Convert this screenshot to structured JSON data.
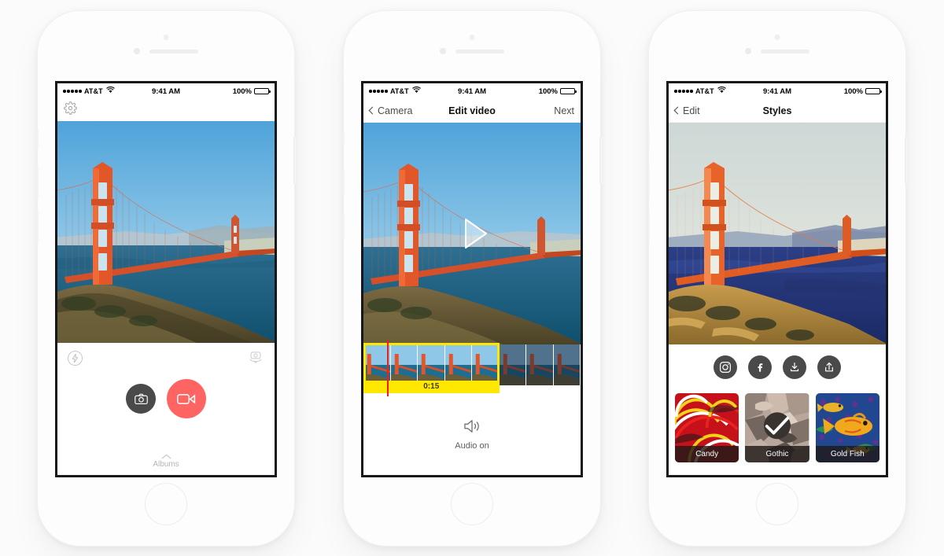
{
  "theme": {
    "page_bg": "#fbfbfc",
    "accent_red": "#fd6462",
    "trim_yellow": "#ffe800",
    "playhead_red": "#f11c1c",
    "dark_button": "#4a4a4a"
  },
  "status_bar": {
    "signal_dots": 5,
    "carrier": "AT&T",
    "wifi_icon": "wifi-icon",
    "time": "9:41 AM",
    "battery_percent": "100%",
    "battery_icon": "battery-full-icon"
  },
  "phones": [
    {
      "id": "camera",
      "nav": {
        "gear_icon": "gear-icon"
      },
      "controls": {
        "flash_icon": "flash-icon",
        "flip_camera_icon": "camera-flip-icon",
        "photo_button_icon": "camera-icon",
        "video_button_icon": "video-camera-icon",
        "albums_label": "Albums",
        "albums_caret_icon": "chevron-up-icon"
      }
    },
    {
      "id": "edit-video",
      "nav": {
        "back_label": "Camera",
        "back_icon": "chevron-left-icon",
        "title": "Edit video",
        "next_label": "Next"
      },
      "player": {
        "play_icon": "play-triangle-icon"
      },
      "timeline": {
        "duration_label": "0:15",
        "total_frames": 8,
        "selected_frames": 5,
        "playhead_position_percent": 11
      },
      "audio": {
        "icon": "speaker-on-icon",
        "label": "Audio on"
      }
    },
    {
      "id": "styles",
      "nav": {
        "back_label": "Edit",
        "back_icon": "chevron-left-icon",
        "title": "Styles"
      },
      "share_buttons": [
        {
          "name": "instagram-icon",
          "label": "Instagram"
        },
        {
          "name": "facebook-icon",
          "label": "Facebook"
        },
        {
          "name": "download-icon",
          "label": "Download"
        },
        {
          "name": "share-icon",
          "label": "Share"
        }
      ],
      "styles": [
        {
          "label": "Candy",
          "selected": false
        },
        {
          "label": "Gothic",
          "selected": true
        },
        {
          "label": "Gold Fish",
          "selected": false
        }
      ],
      "selected_check_icon": "check-icon"
    }
  ]
}
